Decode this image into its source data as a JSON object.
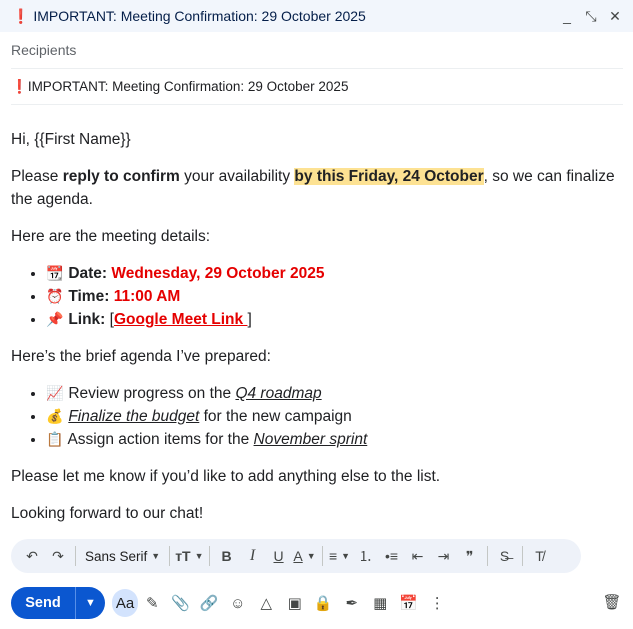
{
  "window": {
    "title_mark": "❗",
    "title": "IMPORTANT: Meeting Confirmation: 29 October 2025",
    "controls": {
      "minimize": "_",
      "exit_fullscreen": "⤡",
      "close": "✕"
    }
  },
  "compose": {
    "recipients_placeholder": "Recipients",
    "subject_mark": "❗",
    "subject": "IMPORTANT: Meeting Confirmation: 29 October 2025"
  },
  "body": {
    "greeting": "Hi, {{First Name}}",
    "p1_a": "Please ",
    "p1_b": "reply to confirm",
    "p1_c": " your availability ",
    "p1_d": "by this Friday, 24 October",
    "p1_e": ", so we can finalize the agenda.",
    "details_intro": "Here are the meeting details:",
    "details": {
      "date_icon": "📆",
      "date_label": "Date:",
      "date_value": "Wednesday, 29 October 2025",
      "time_icon": "⏰",
      "time_label": "Time:",
      "time_value": "11:00 AM",
      "link_icon": "📌",
      "link_label": "Link:",
      "link_open": "[",
      "link_text": "Google Meet Link ",
      "link_close": "]"
    },
    "agenda_intro": "Here’s the brief agenda I’ve prepared:",
    "agenda": {
      "i1_icon": "📈",
      "i1_a": "Review progress on the ",
      "i1_b": "Q4 roadmap",
      "i2_icon": "💰",
      "i2_a": "Finalize the budget",
      "i2_b": " for the new campaign",
      "i3_icon": "📋",
      "i3_a": "Assign action items for the ",
      "i3_b": "November sprint"
    },
    "closing1": "Please let me know if you’d like to add anything else to the list.",
    "closing2": "Looking forward to our chat!"
  },
  "format_toolbar": {
    "undo": "↶",
    "redo": "↷",
    "font": "Sans Serif",
    "size_icon": "тT",
    "bold": "B",
    "italic": "I",
    "underline": "U",
    "text_color": "A",
    "align": "≡",
    "numbered_list": "⒈",
    "bulleted_list": "•≡",
    "indent_less": "⇤",
    "indent_more": "⇥",
    "quote": "❞",
    "strikethrough": "S̶",
    "remove_formatting": "T̸"
  },
  "bottom_toolbar": {
    "send_label": "Send",
    "send_options": "▼",
    "format_options": "Aa",
    "icons": [
      "magic-wand-icon",
      "paperclip-icon",
      "link-icon",
      "emoji-icon",
      "drive-icon",
      "image-icon",
      "lock-clock-icon",
      "pen-icon",
      "layout-icon",
      "calendar-icon",
      "more-icon"
    ],
    "glyphs": {
      "magic": "✎",
      "attach": "📎",
      "link": "🔗",
      "emoji": "☺",
      "drive": "△",
      "photo": "▣",
      "confidential": "🔒",
      "signature": "✒",
      "layouts": "▦",
      "schedule": "📅",
      "more": "⋮",
      "trash": "🗑"
    }
  },
  "colors": {
    "accent": "#0b57d0",
    "highlight": "#fde293",
    "emphasis_red": "#e50000",
    "titlebar": "#f2f6fc"
  }
}
